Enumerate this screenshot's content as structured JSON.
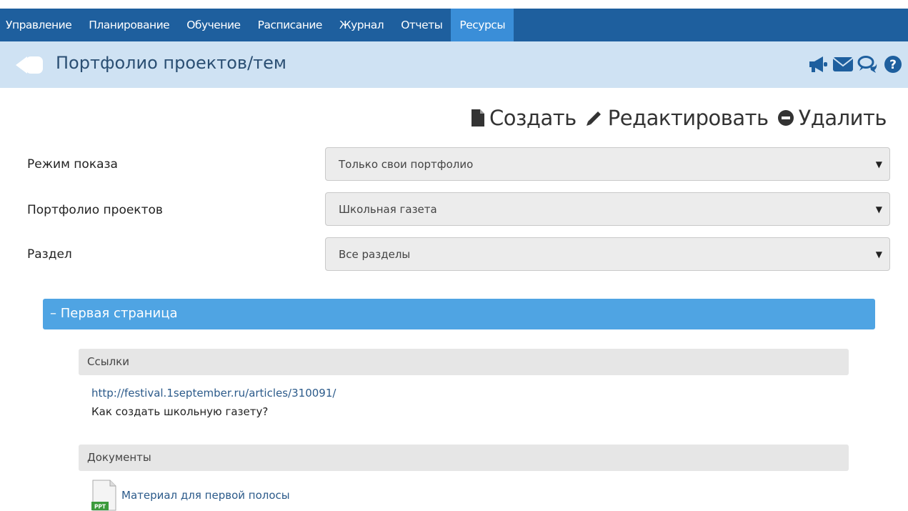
{
  "nav": {
    "items": [
      {
        "label": "Управление"
      },
      {
        "label": "Планирование"
      },
      {
        "label": "Обучение"
      },
      {
        "label": "Расписание"
      },
      {
        "label": "Журнал"
      },
      {
        "label": "Отчеты"
      },
      {
        "label": "Ресурсы",
        "active": true
      }
    ]
  },
  "header": {
    "title": "Портфолио проектов/тем",
    "icons": [
      "megaphone-icon",
      "envelope-icon",
      "chat-icon",
      "help-icon"
    ]
  },
  "toolbar": {
    "create_label": "Создать",
    "edit_label": "Редактировать",
    "delete_label": "Удалить"
  },
  "form": {
    "mode": {
      "label": "Режим показа",
      "value": "Только свои портфолио"
    },
    "portfolio": {
      "label": "Портфолио проектов",
      "value": "Школьная газета"
    },
    "section": {
      "label": "Раздел",
      "value": "Все разделы"
    }
  },
  "accordion": {
    "title": "– Первая страница",
    "links": {
      "header": "Ссылки",
      "url": "http://festival.1september.ru/articles/310091/",
      "description": "Как создать школьную газету?"
    },
    "documents": {
      "header": "Документы",
      "file_name": "Материал для первой полосы",
      "file_type": "PPT"
    }
  },
  "colors": {
    "nav_bg": "#1e5f9e",
    "nav_active": "#3a8ed8",
    "title_bar": "#cfe2f3",
    "accordion": "#4fa4e3"
  }
}
